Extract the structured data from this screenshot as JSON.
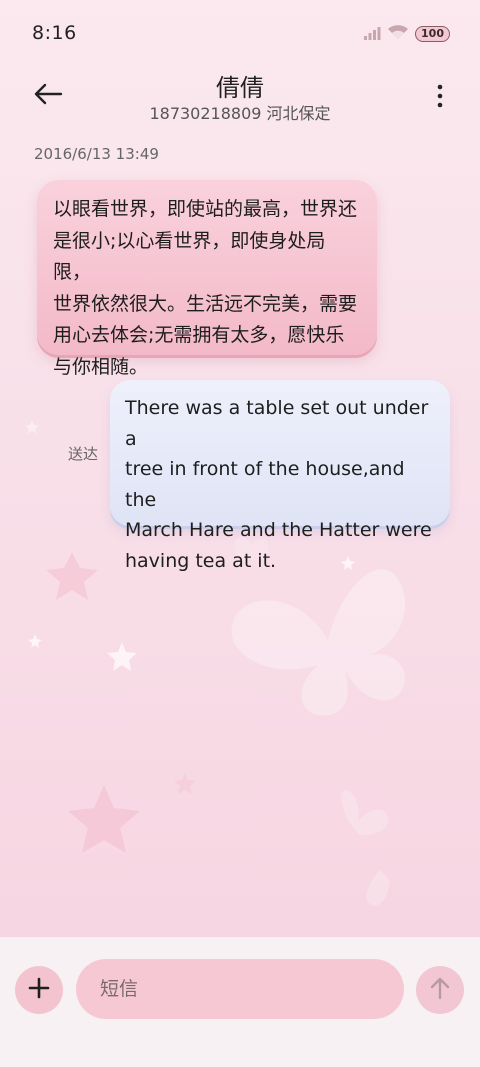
{
  "status_bar": {
    "time": "8:16",
    "battery": "100"
  },
  "header": {
    "contact_name": "倩倩",
    "contact_sub": "18730218809 河北保定"
  },
  "conversation": {
    "timestamp": "2016/6/13 13:49",
    "incoming": [
      "以眼看世界，即使站的最高，世界还",
      "是很小;以心看世界，即使身处局限，",
      "世界依然很大。生活远不完美，需要",
      "用心去体会;无需拥有太多，愿快乐",
      "与你相随。"
    ],
    "outgoing": [
      "There was a table set out under a",
      "tree in front of the house,and the",
      "March Hare and the Hatter were",
      "having tea at it."
    ],
    "sent_status": "送达"
  },
  "composer": {
    "placeholder": "短信"
  },
  "colors": {
    "background": "#f8dfe8",
    "incoming_bubble": "#f3b9c9",
    "outgoing_bubble": "#dfe4f6"
  },
  "icons": [
    "wifi-icon",
    "signal-icon",
    "back-arrow-icon",
    "more-vert-icon",
    "plus-icon",
    "send-arrow-icon"
  ]
}
